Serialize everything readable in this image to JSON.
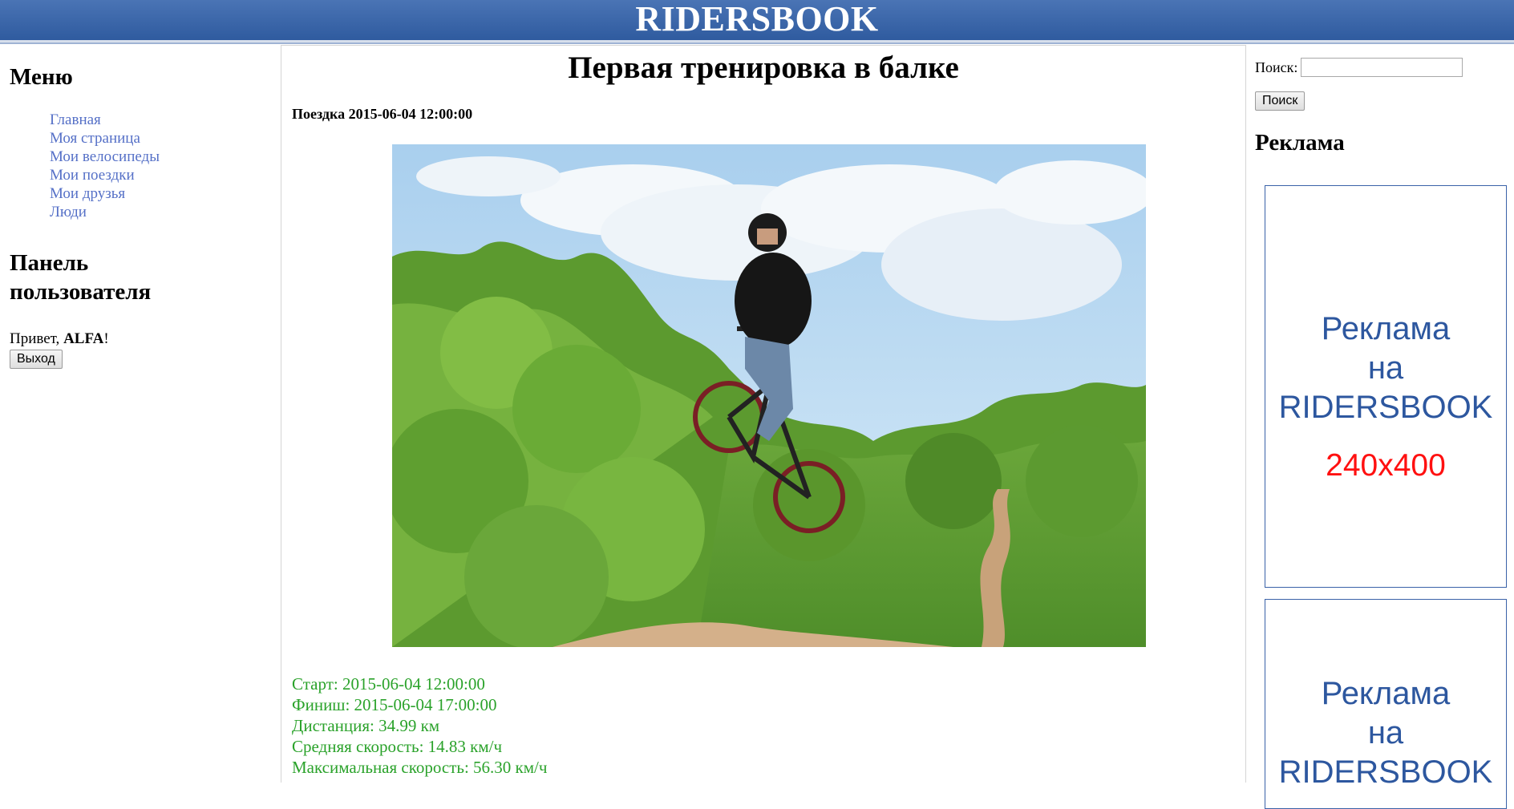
{
  "site": {
    "title": "RIDERSBOOK"
  },
  "menu": {
    "heading": "Меню",
    "items": [
      {
        "label": "Главная"
      },
      {
        "label": "Моя страница"
      },
      {
        "label": "Мои велосипеды"
      },
      {
        "label": "Мои поездки"
      },
      {
        "label": "Мои друзья"
      },
      {
        "label": "Люди"
      }
    ]
  },
  "user_panel": {
    "heading": "Панель пользователя",
    "greeting_prefix": "Привет, ",
    "username": "ALFA",
    "greeting_suffix": "!",
    "logout_label": "Выход"
  },
  "post": {
    "title": "Первая тренировка в балке",
    "meta": "Поездка 2015-06-04 12:00:00",
    "stats": [
      "Старт: 2015-06-04 12:00:00",
      "Финиш: 2015-06-04 17:00:00",
      "Дистанция: 34.99 км",
      "Средняя скорость: 14.83 км/ч",
      "Максимальная скорость: 56.30 км/ч"
    ]
  },
  "search": {
    "label": "Поиск:",
    "value": "",
    "button_label": "Поиск"
  },
  "ads": {
    "heading": "Реклама",
    "banners": [
      {
        "line1": "Реклама",
        "line2": "на",
        "line3": "RIDERSBOOK",
        "size": "240x400"
      },
      {
        "line1": "Реклама",
        "line2": "на",
        "line3": "RIDERSBOOK",
        "size": ""
      }
    ]
  }
}
